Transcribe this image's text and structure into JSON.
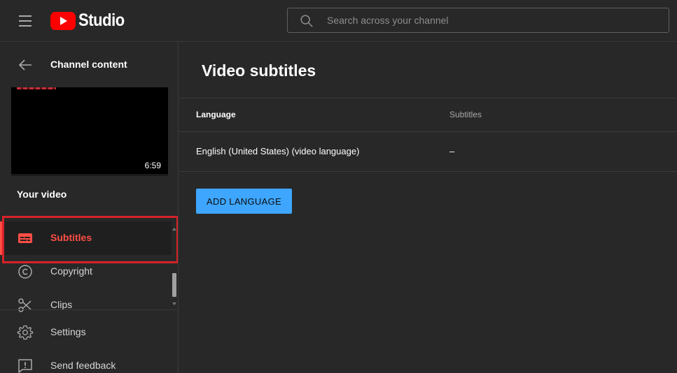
{
  "app": {
    "logo_text": "Studio",
    "brand_color": "#ff0000"
  },
  "search": {
    "placeholder": "Search across your channel",
    "value": ""
  },
  "sidebar": {
    "back_label": "Channel content",
    "video_duration": "6:59",
    "your_video_label": "Your video",
    "items": [
      {
        "label": "Subtitles",
        "icon": "subtitles-icon",
        "active": true
      },
      {
        "label": "Copyright",
        "icon": "copyright-icon",
        "active": false
      },
      {
        "label": "Clips",
        "icon": "scissors-icon",
        "active": false
      },
      {
        "label": "Settings",
        "icon": "gear-icon",
        "active": false
      },
      {
        "label": "Send feedback",
        "icon": "feedback-icon",
        "active": false
      }
    ],
    "active_color": "#ff4e45",
    "highlight_color": "#d62229"
  },
  "main": {
    "title": "Video subtitles",
    "table": {
      "headers": [
        "Language",
        "Subtitles"
      ],
      "rows": [
        [
          "English (United States) (video language)",
          "–"
        ]
      ]
    },
    "add_language_label": "ADD LANGUAGE",
    "button_color": "#3ea6ff"
  }
}
